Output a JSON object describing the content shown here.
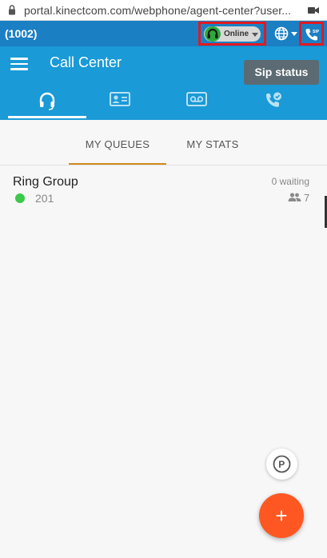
{
  "browser": {
    "url": "portal.kinectcom.com/webphone/agent-center?user..."
  },
  "topbar": {
    "extension": "(1002)",
    "status": "Online"
  },
  "header": {
    "title": "Call Center",
    "sip_status_label": "Sip status",
    "nav_icons": [
      "headset-icon",
      "contact-card-icon",
      "voicemail-icon",
      "phone-check-icon"
    ]
  },
  "tabs": {
    "queues": "MY QUEUES",
    "stats": "MY STATS"
  },
  "queue": {
    "name": "Ring Group",
    "extension": "201",
    "waiting": "0 waiting",
    "agents": "7"
  },
  "actions": {
    "add_label": "+"
  },
  "colors": {
    "topbar": "#1b7fc4",
    "header": "#1a9ad6",
    "highlight": "#e01a22",
    "online": "#2da93b",
    "tab_underline": "#d08a1e",
    "fab": "#ff5722"
  }
}
